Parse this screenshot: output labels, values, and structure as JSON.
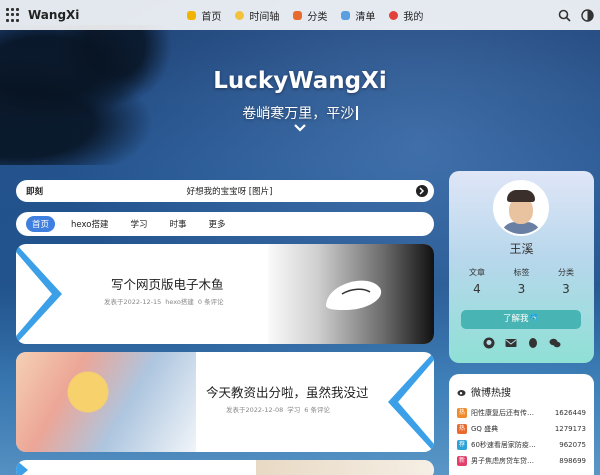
{
  "nav": {
    "brand": "WangXi",
    "links": [
      {
        "label": "首页",
        "icon": "home-icon",
        "color": "#f0b400"
      },
      {
        "label": "时间轴",
        "icon": "clock-icon",
        "color": "#f3c23d"
      },
      {
        "label": "分类",
        "icon": "category-icon",
        "color": "#e86a2c"
      },
      {
        "label": "清单",
        "icon": "list-icon",
        "color": "#5aa0e0"
      },
      {
        "label": "我的",
        "icon": "user-icon",
        "color": "#e2403a"
      }
    ]
  },
  "hero": {
    "title": "LuckyWangXi",
    "subtitle": "卷峭寒万里，平沙"
  },
  "notice": {
    "label": "即刻",
    "text": "好想我的宝宝呀 [图片]"
  },
  "tabs": [
    "首页",
    "hexo搭建",
    "学习",
    "时事",
    "更多"
  ],
  "posts": [
    {
      "title": "写个网页版电子木鱼",
      "date": "发表于2022-12-15",
      "category": "hexo搭建",
      "comments": "0 条评论"
    },
    {
      "title": "今天教资出分啦，虽然我没过",
      "date": "发表于2022-12-08",
      "category": "学习",
      "comments": "6 条评论"
    }
  ],
  "profile": {
    "name": "王溪",
    "stats": [
      {
        "label": "文章",
        "value": "4"
      },
      {
        "label": "标签",
        "value": "3"
      },
      {
        "label": "分类",
        "value": "3"
      }
    ],
    "about_label": "了解我🐬"
  },
  "hot": {
    "title": "微博热搜",
    "items": [
      {
        "rank": "热",
        "title": "阳性康复后还有传…",
        "count": "1626449",
        "color": "#f08a2a"
      },
      {
        "rank": "热",
        "title": "GQ 盛典",
        "count": "1279173",
        "color": "#e86a2c"
      },
      {
        "rank": "荐",
        "title": "60秒速看居家防疫…",
        "count": "962075",
        "color": "#2aa4d8"
      },
      {
        "rank": "新",
        "title": "男子焦虑房贷车贷…",
        "count": "898699",
        "color": "#e2406a"
      }
    ]
  }
}
